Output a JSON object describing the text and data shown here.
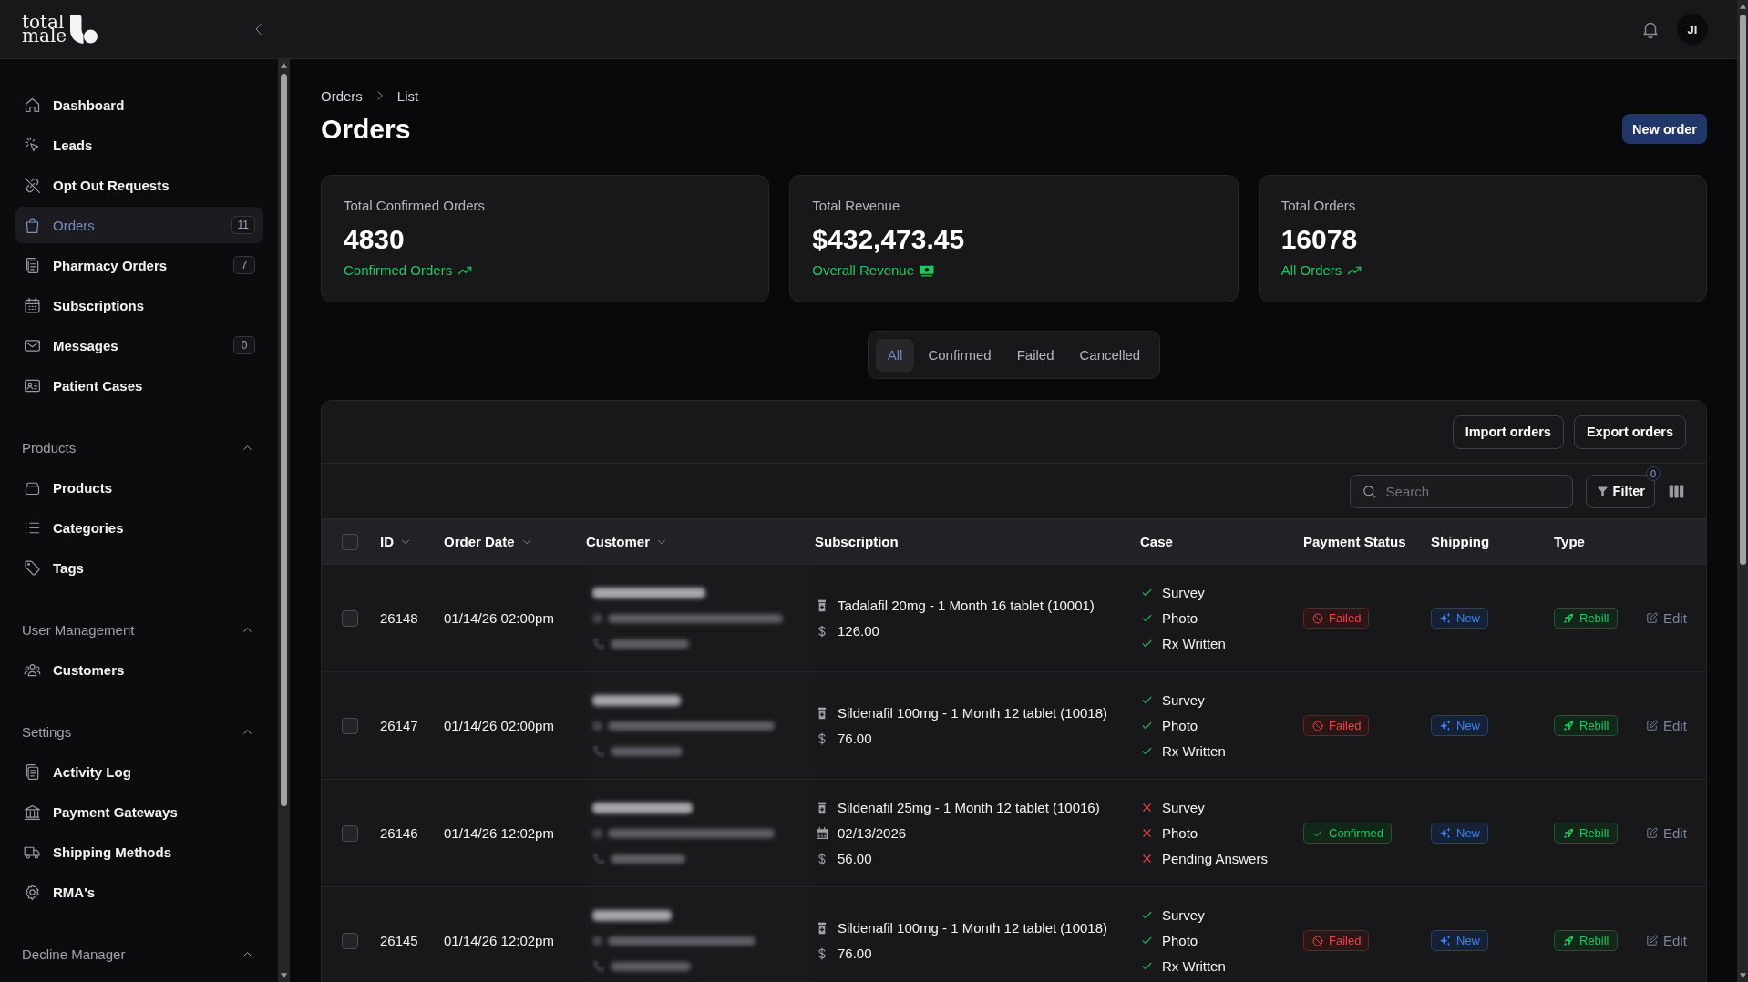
{
  "sidebar": {
    "logo": [
      "total",
      "male"
    ],
    "nav": [
      {
        "label": "Dashboard",
        "selected": false
      },
      {
        "label": "Leads",
        "selected": false
      },
      {
        "label": "Opt Out Requests",
        "selected": false
      },
      {
        "label": "Orders",
        "selected": true,
        "badge": "11"
      },
      {
        "label": "Pharmacy Orders",
        "selected": false,
        "badge": "7"
      },
      {
        "label": "Subscriptions",
        "selected": false
      },
      {
        "label": "Messages",
        "selected": false,
        "badge": "0"
      },
      {
        "label": "Patient Cases",
        "selected": false
      }
    ],
    "sections": [
      {
        "title": "Products",
        "expanded": true,
        "items": [
          {
            "label": "Products",
            "selected": false
          },
          {
            "label": "Categories",
            "selected": false
          },
          {
            "label": "Tags",
            "selected": false
          }
        ]
      },
      {
        "title": "User Management",
        "expanded": true,
        "items": [
          {
            "label": "Customers",
            "selected": false
          }
        ]
      },
      {
        "title": "Settings",
        "expanded": true,
        "items": [
          {
            "label": "Activity Log",
            "selected": false
          },
          {
            "label": "Payment Gateways",
            "selected": false
          },
          {
            "label": "Shipping Methods",
            "selected": false
          },
          {
            "label": "RMA's",
            "selected": false
          }
        ]
      },
      {
        "title": "Decline Manager",
        "expanded": true
      }
    ]
  },
  "header": {
    "avatar": "JI"
  },
  "breadcrumb": [
    "Orders",
    "List"
  ],
  "title": "Orders",
  "new_order_button": "New order",
  "stats": [
    {
      "label": "Total Confirmed Orders",
      "value": "4830",
      "link": "Confirmed Orders",
      "kind": "trend"
    },
    {
      "label": "Total Revenue",
      "value": "$432,473.45",
      "link": "Overall Revenue",
      "kind": "money"
    },
    {
      "label": "Total Orders",
      "value": "16078",
      "link": "All Orders",
      "kind": "trend"
    }
  ],
  "filter_tabs": [
    {
      "label": "All",
      "selected": true
    },
    {
      "label": "Confirmed",
      "selected": false
    },
    {
      "label": "Failed",
      "selected": false
    },
    {
      "label": "Cancelled",
      "selected": false
    }
  ],
  "table": {
    "actions": [
      "Import orders",
      "Export orders"
    ],
    "search": {
      "placeholder": "Search"
    },
    "filter": {
      "label": "Filter",
      "count": "0"
    },
    "select_all": {
      "checked": false
    },
    "columns": [
      {
        "label": "ID",
        "sortable": true
      },
      {
        "label": "Order Date",
        "sortable": true
      },
      {
        "label": "Customer",
        "sortable": true
      },
      {
        "label": "Subscription",
        "sortable": false
      },
      {
        "label": "Case",
        "sortable": false
      },
      {
        "label": "Payment Status",
        "sortable": false
      },
      {
        "label": "Shipping",
        "sortable": false
      },
      {
        "label": "Type",
        "sortable": false
      }
    ],
    "rows": [
      {
        "checked": false,
        "id": "26148",
        "date": "01/14/26 02:00pm",
        "subscription": [
          {
            "kind": "product",
            "text": "Tadalafil 20mg - 1 Month 16 tablet (10001)"
          },
          {
            "kind": "price",
            "text": "126.00"
          }
        ],
        "case": [
          {
            "label": "Survey",
            "done": true
          },
          {
            "label": "Photo",
            "done": true
          },
          {
            "label": "Rx Written",
            "done": true
          }
        ],
        "payment": {
          "kind": "failed",
          "label": "Failed"
        },
        "shipping": {
          "kind": "new",
          "label": "New"
        },
        "type": {
          "kind": "rebill",
          "label": "Rebill"
        },
        "action": "Edit"
      },
      {
        "checked": false,
        "id": "26147",
        "date": "01/14/26 02:00pm",
        "subscription": [
          {
            "kind": "product",
            "text": "Sildenafil 100mg - 1 Month 12 tablet (10018)"
          },
          {
            "kind": "price",
            "text": "76.00"
          }
        ],
        "case": [
          {
            "label": "Survey",
            "done": true
          },
          {
            "label": "Photo",
            "done": true
          },
          {
            "label": "Rx Written",
            "done": true
          }
        ],
        "payment": {
          "kind": "failed",
          "label": "Failed"
        },
        "shipping": {
          "kind": "new",
          "label": "New"
        },
        "type": {
          "kind": "rebill",
          "label": "Rebill"
        },
        "action": "Edit"
      },
      {
        "checked": false,
        "id": "26146",
        "date": "01/14/26 12:02pm",
        "subscription": [
          {
            "kind": "product",
            "text": "Sildenafil 25mg - 1 Month 12 tablet (10016)"
          },
          {
            "kind": "date",
            "text": "02/13/2026"
          },
          {
            "kind": "price",
            "text": "56.00"
          }
        ],
        "case": [
          {
            "label": "Survey",
            "done": false
          },
          {
            "label": "Photo",
            "done": false
          },
          {
            "label": "Pending Answers",
            "done": false
          }
        ],
        "payment": {
          "kind": "confirmed",
          "label": "Confirmed"
        },
        "shipping": {
          "kind": "new",
          "label": "New"
        },
        "type": {
          "kind": "rebill",
          "label": "Rebill"
        },
        "action": "Edit"
      },
      {
        "checked": false,
        "id": "26145",
        "date": "01/14/26 12:02pm",
        "subscription": [
          {
            "kind": "product",
            "text": "Sildenafil 100mg - 1 Month 12 tablet (10018)"
          },
          {
            "kind": "price",
            "text": "76.00"
          }
        ],
        "case": [
          {
            "label": "Survey",
            "done": true
          },
          {
            "label": "Photo",
            "done": true
          },
          {
            "label": "Rx Written",
            "done": true
          }
        ],
        "payment": {
          "kind": "failed",
          "label": "Failed"
        },
        "shipping": {
          "kind": "new",
          "label": "New"
        },
        "type": {
          "kind": "rebill",
          "label": "Rebill"
        },
        "action": "Edit"
      }
    ]
  }
}
